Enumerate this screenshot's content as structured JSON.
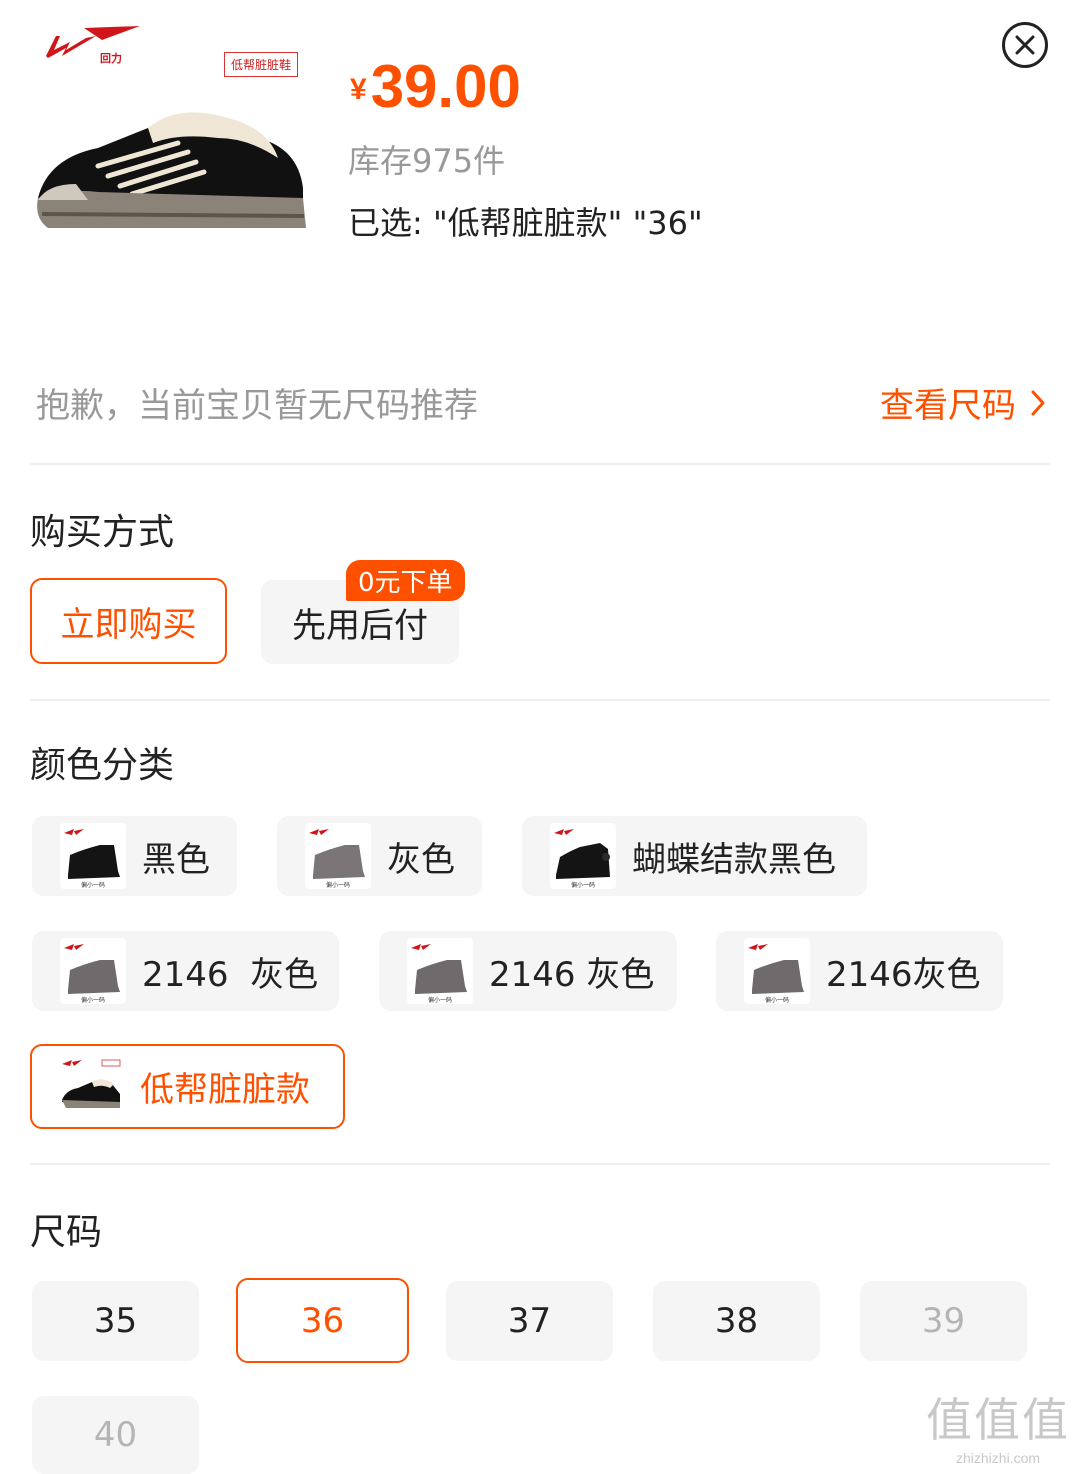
{
  "product": {
    "brand_logo_text": "回力",
    "tag": "低帮脏脏鞋",
    "price_currency": "¥",
    "price": "39.00",
    "stock": "库存975件",
    "selected": "已选: \"低帮脏脏款\" \"36\""
  },
  "size_hint": {
    "message": "抱歉，当前宝贝暂无尺码推荐",
    "link": "查看尺码"
  },
  "purchase": {
    "title": "购买方式",
    "options": [
      {
        "label": "立即购买",
        "selected": true
      },
      {
        "label": "先用后付",
        "badge": "0元下单",
        "selected": false
      }
    ]
  },
  "color": {
    "title": "颜色分类",
    "options": [
      {
        "label": "黑色",
        "icon": "black-boot-thumb",
        "thumb_caption": "偏小一码"
      },
      {
        "label": "灰色",
        "icon": "gray-boot-thumb",
        "thumb_caption": "偏小一码"
      },
      {
        "label": "蝴蝶结款黑色",
        "icon": "black-bow-boot-thumb",
        "thumb_caption": "偏小一码"
      },
      {
        "label": "2146  灰色",
        "icon": "gray-boot-thumb",
        "thumb_caption": "偏小一码"
      },
      {
        "label": "2146 灰色",
        "icon": "gray-boot-thumb",
        "thumb_caption": "偏小一码"
      },
      {
        "label": "2146灰色",
        "icon": "gray-boot-thumb",
        "thumb_caption": "偏小一码"
      },
      {
        "label": "低帮脏脏款",
        "icon": "lowtop-sneaker-thumb",
        "selected": true
      }
    ]
  },
  "size": {
    "title": "尺码",
    "options": [
      {
        "label": "35"
      },
      {
        "label": "36",
        "selected": true
      },
      {
        "label": "37"
      },
      {
        "label": "38"
      },
      {
        "label": "39",
        "disabled": true
      },
      {
        "label": "40",
        "disabled": true
      }
    ]
  },
  "watermark": {
    "big": "值值值",
    "small": "zhizhizhi.com"
  },
  "colors": {
    "accent": "#ff5000",
    "chip_bg": "#f5f5f5",
    "muted": "#999999"
  }
}
